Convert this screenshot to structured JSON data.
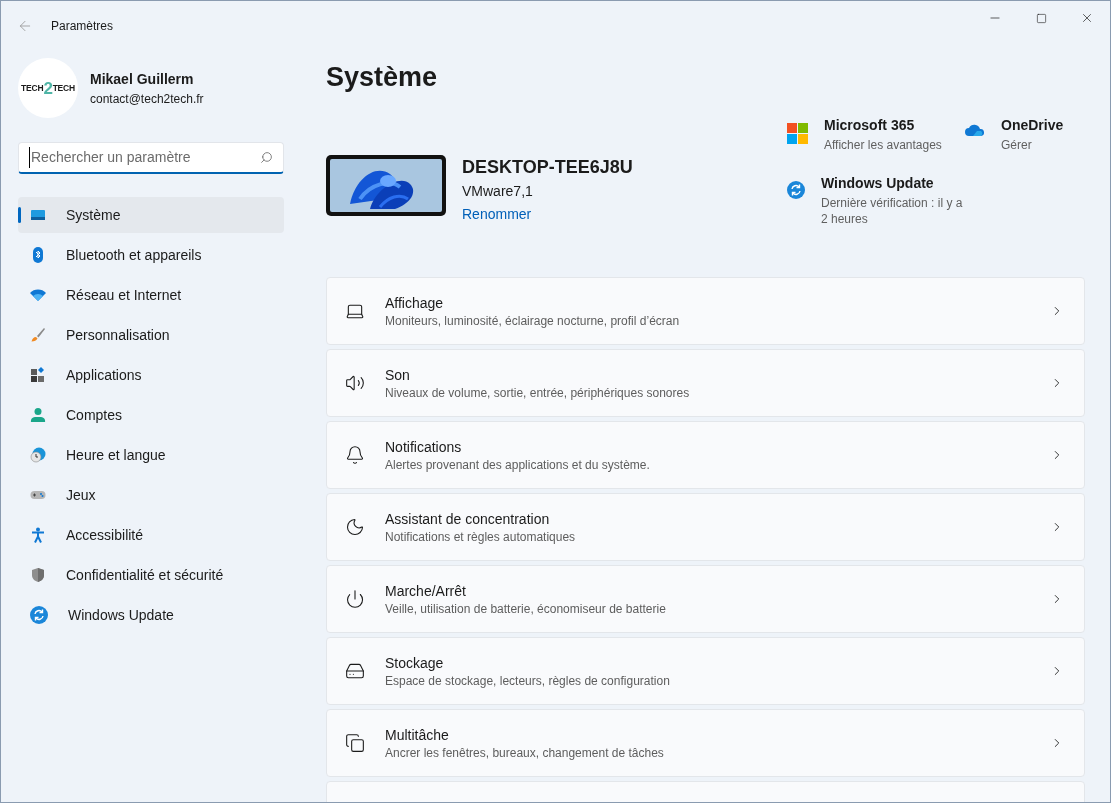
{
  "window": {
    "title": "Paramètres"
  },
  "profile": {
    "name": "Mikael Guillerm",
    "email": "contact@tech2tech.fr",
    "avatar": {
      "left": "TECH",
      "digit": "2",
      "right": "TECH"
    }
  },
  "search": {
    "placeholder": "Rechercher un paramètre"
  },
  "sidebar": {
    "items": [
      {
        "label": "Système",
        "selected": true
      },
      {
        "label": "Bluetooth et appareils",
        "selected": false
      },
      {
        "label": "Réseau et Internet",
        "selected": false
      },
      {
        "label": "Personnalisation",
        "selected": false
      },
      {
        "label": "Applications",
        "selected": false
      },
      {
        "label": "Comptes",
        "selected": false
      },
      {
        "label": "Heure et langue",
        "selected": false
      },
      {
        "label": "Jeux",
        "selected": false
      },
      {
        "label": "Accessibilité",
        "selected": false
      },
      {
        "label": "Confidentialité et sécurité",
        "selected": false
      },
      {
        "label": "Windows Update",
        "selected": false
      }
    ]
  },
  "page": {
    "title": "Système",
    "device": {
      "name": "DESKTOP-TEE6J8U",
      "model": "VMware7,1",
      "rename": "Renommer"
    },
    "quick_links": [
      {
        "title": "Microsoft 365",
        "subtitle": "Afficher les avantages"
      },
      {
        "title": "OneDrive",
        "subtitle": "Gérer"
      },
      {
        "title": "Windows Update",
        "subtitle": "Dernière vérification : il y a 2 heures"
      }
    ],
    "cards": [
      {
        "title": "Affichage",
        "subtitle": "Moniteurs, luminosité, éclairage nocturne, profil d’écran"
      },
      {
        "title": "Son",
        "subtitle": "Niveaux de volume, sortie, entrée, périphériques sonores"
      },
      {
        "title": "Notifications",
        "subtitle": "Alertes provenant des applications et du système."
      },
      {
        "title": "Assistant de concentration",
        "subtitle": "Notifications et règles automatiques"
      },
      {
        "title": "Marche/Arrêt",
        "subtitle": "Veille, utilisation de batterie, économiseur de batterie"
      },
      {
        "title": "Stockage",
        "subtitle": "Espace de stockage, lecteurs, règles de configuration"
      },
      {
        "title": "Multitâche",
        "subtitle": "Ancrer les fenêtres, bureaux, changement de tâches"
      }
    ]
  }
}
